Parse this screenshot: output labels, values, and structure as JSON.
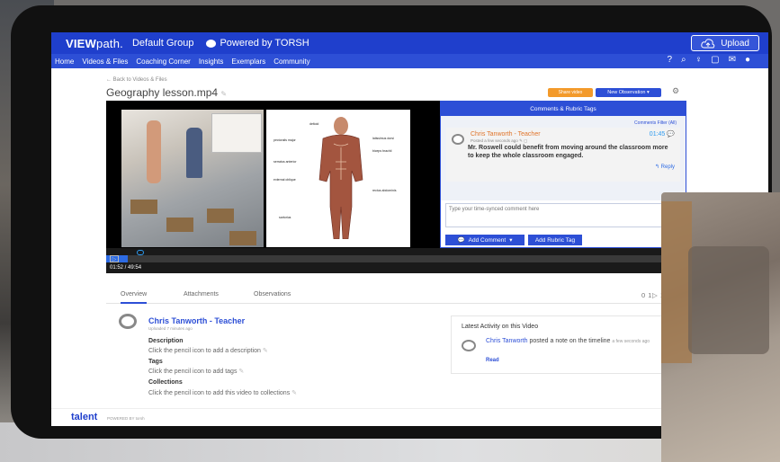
{
  "header": {
    "logo_bold": "VIEW",
    "logo_light": "path.",
    "group": "Default Group",
    "powered": "Powered by TORSH",
    "upload_label": "Upload"
  },
  "nav": {
    "items": [
      "Home",
      "Videos & Files",
      "Coaching Corner",
      "Insights",
      "Exemplars",
      "Community"
    ],
    "icons": [
      "help-icon",
      "search-icon",
      "lightbulb-icon",
      "calendar-icon",
      "notifications-icon",
      "user-avatar-icon"
    ]
  },
  "page": {
    "back_link": "← Back to Videos & Files",
    "file_title": "Geography lesson.mp4",
    "share_label": "Share video",
    "new_observation_label": "New Observation ▾"
  },
  "video": {
    "time": "01:52 / 49:54",
    "progress_fraction": 0.0374,
    "anatomy_labels": [
      "deltoid",
      "pectoralis major",
      "latissimus dorsi",
      "biceps brachii",
      "serratus anterior",
      "external oblique",
      "rectus abdominis",
      "sartorius"
    ]
  },
  "comments_panel": {
    "title": "Comments & Rubric Tags",
    "filter": "Comments Filter (All)",
    "comment": {
      "author": "Chris Tanworth - Teacher",
      "meta": "Posted a few seconds ago",
      "timestamp": "01:45",
      "text": "Mr. Roswell could benefit from moving around the classroom more to keep the whole classroom engaged.",
      "reply": "Reply"
    },
    "input_placeholder": "Type your time-synced comment here",
    "add_comment": "Add Comment",
    "add_rubric": "Add Rubric Tag"
  },
  "tabs": {
    "items": [
      "Overview",
      "Attachments",
      "Observations"
    ],
    "counts": "0 1▷ 1 0 0"
  },
  "overview": {
    "name": "Chris Tanworth - Teacher",
    "uploaded": "Uploaded 7 minutes ago",
    "description_h": "Description",
    "description_t": "Click the pencil icon to add a description",
    "tags_h": "Tags",
    "tags_t": "Click the pencil icon to add tags",
    "collections_h": "Collections",
    "collections_t": "Click the pencil icon to add this video to collections"
  },
  "activity": {
    "title": "Latest Activity on this Video",
    "who": "Chris Tanworth",
    "action": "posted a note on the timeline",
    "when": "a few seconds ago",
    "read": "Read"
  },
  "footer": {
    "brand": "talent",
    "powered": "POWERED BY torsh"
  }
}
